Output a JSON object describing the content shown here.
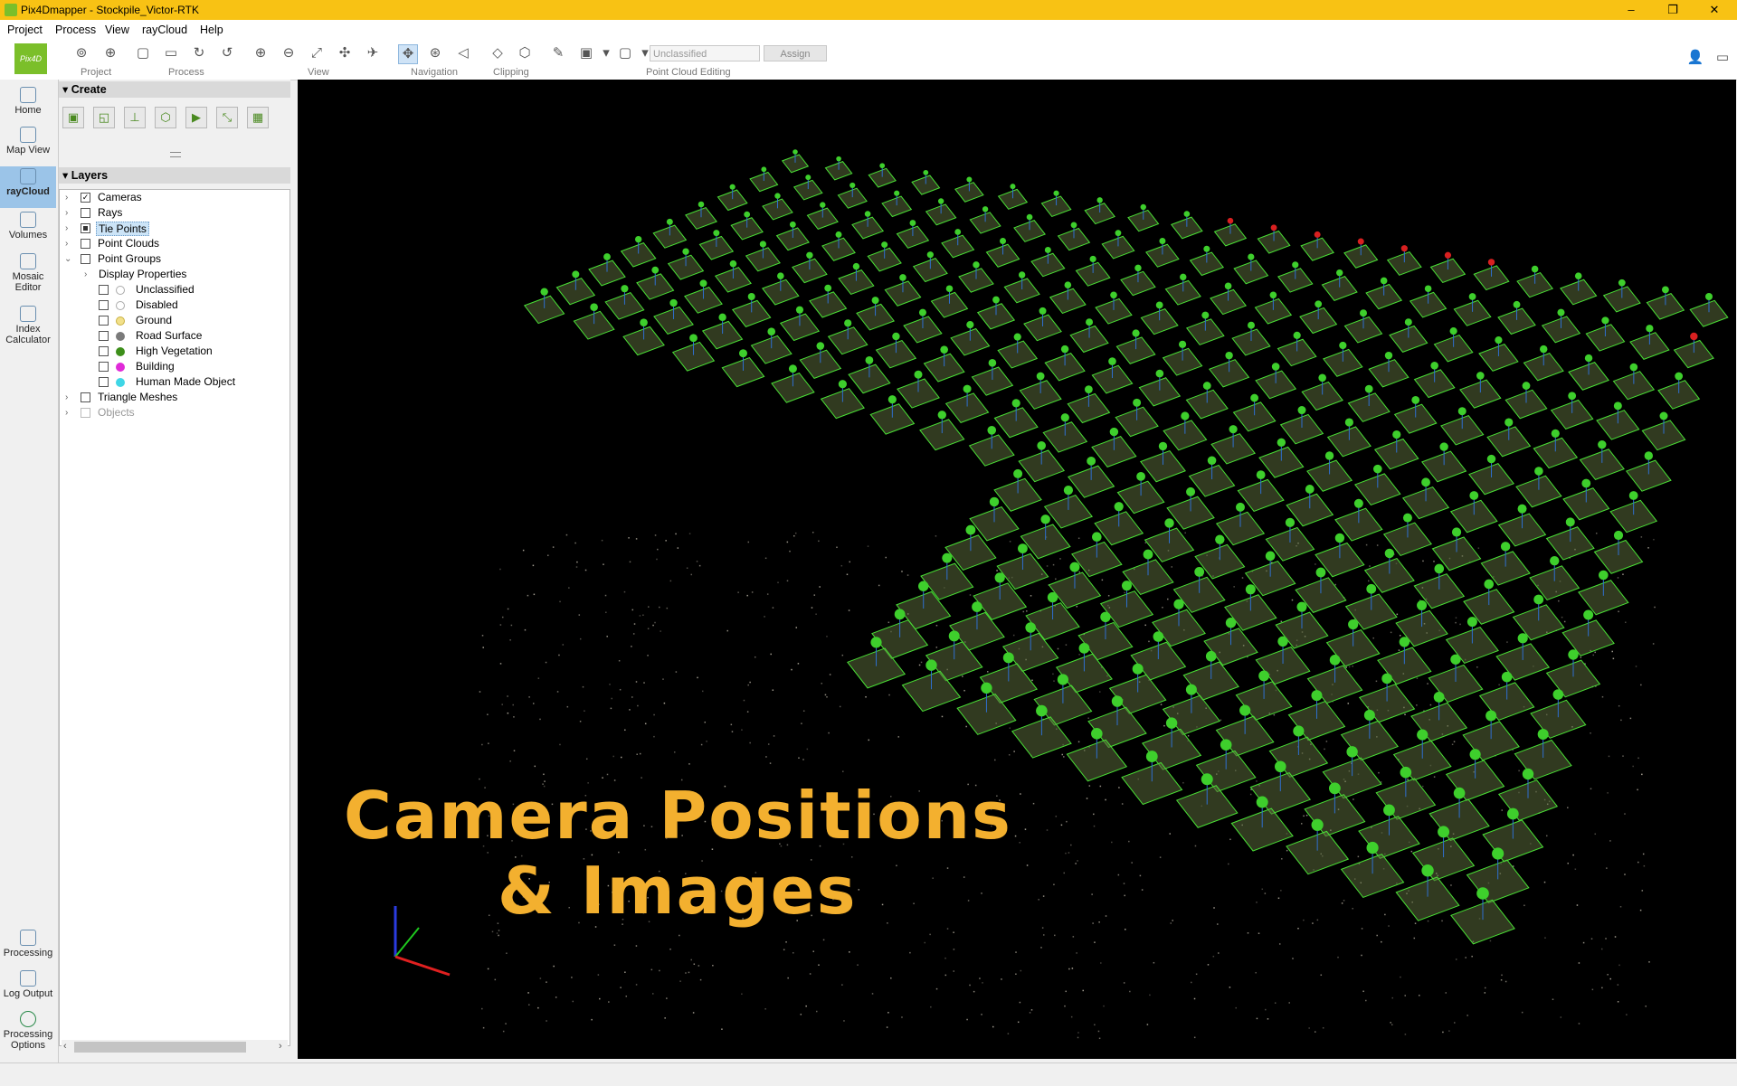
{
  "window": {
    "title": "Pix4Dmapper - Stockpile_Victor-RTK",
    "min": "–",
    "max": "❐",
    "close": "✕"
  },
  "menu": [
    "Project",
    "Process",
    "View",
    "rayCloud",
    "Help"
  ],
  "logo_text": "Pix4D",
  "toolbar": {
    "groups": [
      "Project",
      "Process",
      "View",
      "Navigation",
      "Clipping",
      "Point Cloud Editing"
    ],
    "class_dropdown": "Unclassified",
    "assign_label": "Assign"
  },
  "nav": {
    "items": [
      {
        "label": "Home",
        "icon": "home-icon"
      },
      {
        "label": "Map View",
        "icon": "map-icon"
      },
      {
        "label": "rayCloud",
        "icon": "raycloud-icon"
      },
      {
        "label": "Volumes",
        "icon": "volumes-icon"
      },
      {
        "label": "Mosaic Editor",
        "icon": "mosaic-icon"
      },
      {
        "label": "Index Calculator",
        "icon": "index-icon"
      }
    ],
    "bottom": [
      {
        "label": "Processing",
        "icon": "processing-icon"
      },
      {
        "label": "Log Output",
        "icon": "log-icon"
      },
      {
        "label": "Processing Options",
        "icon": "gear-icon"
      }
    ]
  },
  "panel": {
    "create_title": "Create",
    "layers_title": "Layers",
    "tree": [
      {
        "label": "Cameras",
        "checked": true
      },
      {
        "label": "Rays",
        "checked": false
      },
      {
        "label": "Tie Points",
        "checked": "partial"
      },
      {
        "label": "Point Clouds",
        "checked": false
      },
      {
        "label": "Point Groups",
        "checked": false
      },
      {
        "label": "Display Properties"
      },
      {
        "label": "Unclassified",
        "color": "#ffffff"
      },
      {
        "label": "Disabled",
        "color": "#ffffff"
      },
      {
        "label": "Ground",
        "color": "#f2e08a"
      },
      {
        "label": "Road Surface",
        "color": "#7a7a7a"
      },
      {
        "label": "High Vegetation",
        "color": "#3d8f1a"
      },
      {
        "label": "Building",
        "color": "#e02ad8"
      },
      {
        "label": "Human Made Object",
        "color": "#3fd6e6"
      },
      {
        "label": "Triangle Meshes",
        "checked": false
      },
      {
        "label": "Objects",
        "checked": false
      }
    ]
  },
  "overlay": {
    "line1": "Camera Positions",
    "line2": "& Images",
    "color": "#f3b02f"
  },
  "colors": {
    "titlebar": "#f8c214",
    "camera_green": "#3ecf2c",
    "camera_red": "#d82020",
    "accent": "#7bbf2a"
  }
}
